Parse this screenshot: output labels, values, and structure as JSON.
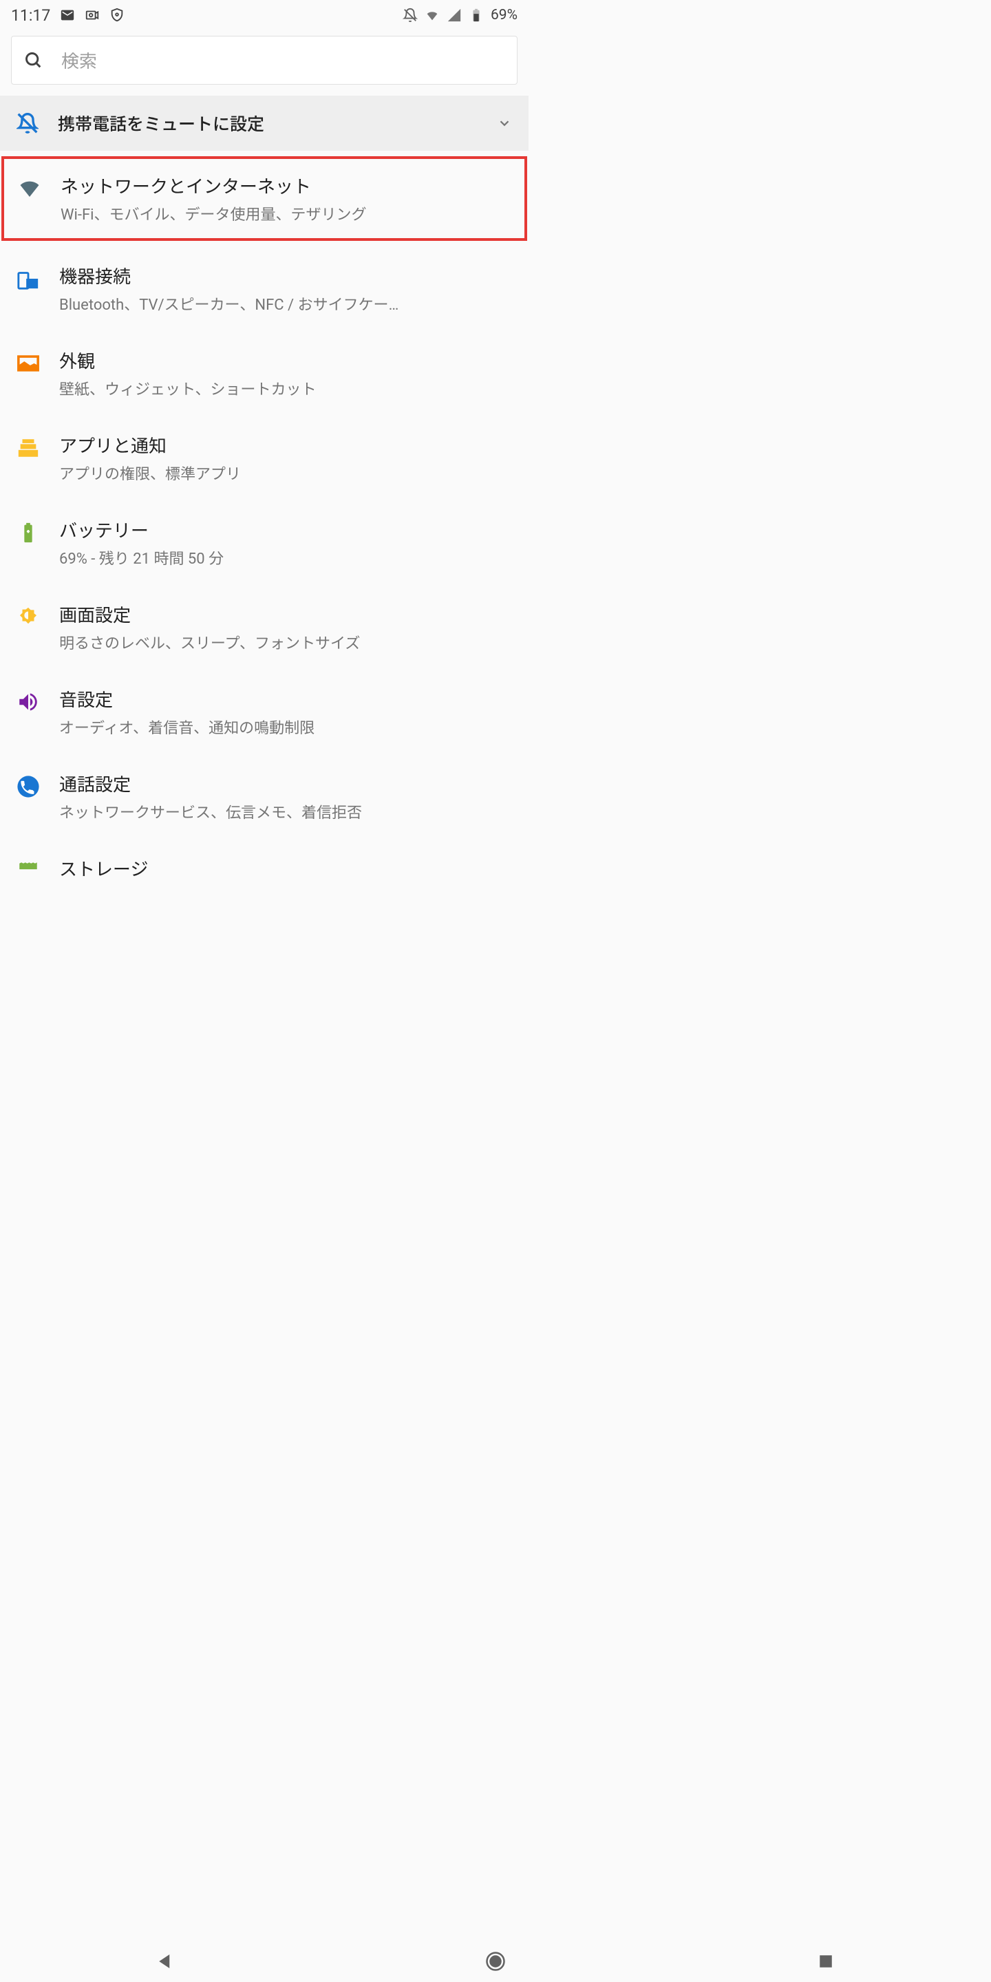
{
  "status": {
    "time": "11:17",
    "battery_text": " 69%"
  },
  "search": {
    "placeholder": "検索"
  },
  "banner": {
    "text": "携帯電話をミュートに設定"
  },
  "items": [
    {
      "title": "ネットワークとインターネット",
      "subtitle": "Wi-Fi、モバイル、データ使用量、テザリング"
    },
    {
      "title": "機器接続",
      "subtitle": "Bluetooth、TV/スピーカー、NFC / おサイフケー…"
    },
    {
      "title": "外観",
      "subtitle": "壁紙、ウィジェット、ショートカット"
    },
    {
      "title": "アプリと通知",
      "subtitle": "アプリの権限、標準アプリ"
    },
    {
      "title": "バッテリー",
      "subtitle": "69% - 残り 21 時間 50 分"
    },
    {
      "title": "画面設定",
      "subtitle": "明るさのレベル、スリープ、フォントサイズ"
    },
    {
      "title": "音設定",
      "subtitle": "オーディオ、着信音、通知の鳴動制限"
    },
    {
      "title": "通話設定",
      "subtitle": "ネットワークサービス、伝言メモ、着信拒否"
    },
    {
      "title": "ストレージ",
      "subtitle": ""
    }
  ]
}
